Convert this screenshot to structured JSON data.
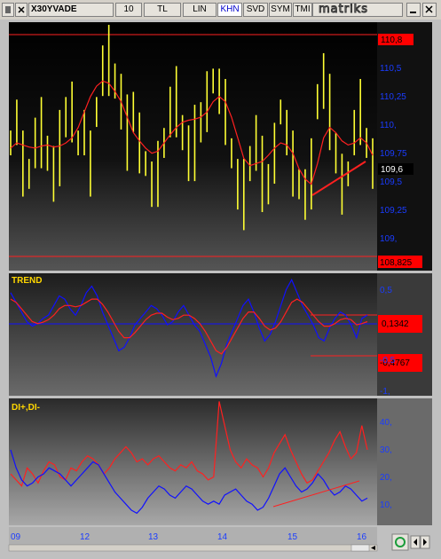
{
  "toolbar": {
    "symbol": "X30YVADE",
    "period": "10",
    "currency": "TL",
    "scale": "LIN",
    "khn": "KHN",
    "svd": "SVD",
    "sym": "SYM",
    "tmi": "TMI",
    "brand": "matriks"
  },
  "colors": {
    "panel_bg_top": "#000000",
    "panel_bg_bottom": "#8a8a8a",
    "price_bars": "#ffff33",
    "moving_average": "#ff2020",
    "trend": "#1010ff",
    "di_minus": "#ff2020",
    "di_plus": "#1010ff",
    "ref_box": "#ff0000",
    "axis_text": "#1a3cff"
  },
  "panels": {
    "price": {
      "axis_labels": [
        "110,5",
        "110,25",
        "110,",
        "109,75",
        "109,5",
        "109,25",
        "109,"
      ],
      "high_label": "110,8",
      "last_label": "109,6",
      "low_label": "108,825"
    },
    "trend": {
      "title": "TREND",
      "axis_labels": [
        "0,5",
        "-0,5",
        "-1,"
      ],
      "upper_label": "0,1342",
      "lower_label": "-0,4767"
    },
    "di": {
      "title": "DI+,DI-",
      "axis_labels": [
        "40,",
        "30,",
        "20,",
        "10,"
      ]
    }
  },
  "x_axis": {
    "labels": [
      "09",
      "12",
      "13",
      "14",
      "15",
      "16"
    ]
  },
  "chart_data": [
    {
      "type": "line",
      "panel": "price",
      "title": "",
      "ylim": [
        108.8,
        110.95
      ],
      "series": [
        {
          "name": "",
          "style": "hl-bars",
          "values": [
            109.9,
            110.1,
            109.7,
            109.6,
            109.9,
            110.0,
            109.8,
            109.6,
            109.85,
            110.15,
            110.2,
            109.9,
            110.0,
            109.7,
            110.2,
            110.6,
            110.7,
            110.5,
            110.3,
            110.0,
            110.2,
            109.9,
            109.7,
            109.5,
            109.6,
            109.9,
            110.2,
            110.3,
            110.0,
            109.8,
            109.9,
            110.1,
            110.3,
            110.5,
            110.4,
            110.2,
            109.8,
            109.5,
            109.4,
            109.7,
            109.9,
            109.6,
            109.5,
            109.8,
            110.2,
            110.0,
            109.7,
            109.5,
            109.4,
            109.6,
            110.3,
            110.5,
            110.2,
            109.8,
            109.5,
            109.6,
            110.0,
            110.2,
            109.9,
            109.7
          ]
        },
        {
          "name": "",
          "values": [
            109.85,
            109.9,
            109.88,
            109.86,
            109.85,
            109.87,
            109.88,
            109.86,
            109.87,
            109.9,
            109.95,
            110.05,
            110.2,
            110.35,
            110.45,
            110.5,
            110.48,
            110.4,
            110.3,
            110.15,
            110.0,
            109.92,
            109.85,
            109.8,
            109.82,
            109.9,
            109.98,
            110.05,
            110.1,
            110.12,
            110.13,
            110.15,
            110.2,
            110.3,
            110.35,
            110.3,
            110.15,
            109.95,
            109.75,
            109.68,
            109.7,
            109.72,
            109.78,
            109.85,
            109.9,
            109.88,
            109.8,
            109.65,
            109.55,
            109.5,
            109.7,
            109.95,
            110.05,
            110.0,
            109.92,
            109.88,
            109.9,
            109.95,
            109.9,
            109.78
          ]
        }
      ]
    },
    {
      "type": "line",
      "panel": "trend",
      "ylim": [
        -1.2,
        0.7
      ],
      "series": [
        {
          "name": "",
          "values": [
            0.4,
            0.25,
            0.1,
            -0.05,
            -0.12,
            -0.08,
            0.0,
            0.05,
            0.2,
            0.35,
            0.3,
            0.15,
            0.05,
            0.2,
            0.4,
            0.5,
            0.35,
            0.1,
            -0.1,
            -0.3,
            -0.5,
            -0.45,
            -0.3,
            -0.1,
            0.0,
            0.1,
            0.2,
            0.15,
            0.05,
            -0.1,
            -0.05,
            0.1,
            0.2,
            0.05,
            -0.1,
            -0.2,
            -0.4,
            -0.6,
            -0.9,
            -0.7,
            -0.4,
            -0.2,
            0.0,
            0.2,
            0.3,
            0.1,
            -0.15,
            -0.35,
            -0.25,
            -0.05,
            0.2,
            0.45,
            0.6,
            0.4,
            0.2,
            0.05,
            -0.1,
            -0.3,
            -0.35,
            -0.15,
            0.0,
            0.1,
            0.05,
            -0.1,
            -0.3,
            0.0,
            0.05
          ]
        },
        {
          "name": "",
          "values": [
            0.3,
            0.25,
            0.15,
            0.05,
            -0.05,
            -0.08,
            -0.06,
            -0.02,
            0.05,
            0.15,
            0.2,
            0.2,
            0.18,
            0.2,
            0.25,
            0.3,
            0.3,
            0.22,
            0.1,
            -0.05,
            -0.2,
            -0.3,
            -0.3,
            -0.22,
            -0.12,
            -0.02,
            0.05,
            0.08,
            0.08,
            0.02,
            -0.02,
            0.0,
            0.05,
            0.05,
            0.0,
            -0.08,
            -0.2,
            -0.35,
            -0.5,
            -0.55,
            -0.45,
            -0.3,
            -0.15,
            0.0,
            0.1,
            0.1,
            0.0,
            -0.12,
            -0.18,
            -0.15,
            -0.05,
            0.1,
            0.25,
            0.3,
            0.25,
            0.15,
            0.05,
            -0.05,
            -0.12,
            -0.12,
            -0.08,
            -0.02,
            0.0,
            -0.02,
            -0.1,
            -0.08,
            -0.05
          ]
        }
      ]
    },
    {
      "type": "line",
      "panel": "di",
      "ylim": [
        5,
        47
      ],
      "series": [
        {
          "name": "",
          "values": [
            22,
            20,
            18,
            24,
            22,
            19,
            23,
            26,
            25,
            21,
            20,
            24,
            23,
            26,
            28,
            27,
            25,
            22,
            24,
            27,
            29,
            31,
            29,
            26,
            27,
            25,
            27,
            28,
            26,
            24,
            23,
            25,
            24,
            26,
            23,
            22,
            20,
            21,
            46,
            38,
            30,
            26,
            24,
            27,
            25,
            24,
            21,
            24,
            29,
            32,
            35,
            30,
            26,
            22,
            19,
            20,
            23,
            26,
            29,
            33,
            36,
            31,
            27,
            29,
            38,
            30
          ]
        },
        {
          "name": "",
          "values": [
            30,
            24,
            20,
            18,
            19,
            21,
            22,
            24,
            23,
            22,
            20,
            18,
            20,
            22,
            24,
            26,
            25,
            22,
            19,
            16,
            14,
            12,
            10,
            9,
            11,
            14,
            16,
            18,
            17,
            15,
            14,
            16,
            18,
            17,
            15,
            13,
            12,
            13,
            12,
            15,
            16,
            17,
            15,
            13,
            12,
            10,
            11,
            14,
            18,
            22,
            24,
            21,
            18,
            16,
            17,
            19,
            22,
            20,
            17,
            15,
            16,
            18,
            17,
            15,
            13,
            14
          ]
        }
      ]
    }
  ]
}
